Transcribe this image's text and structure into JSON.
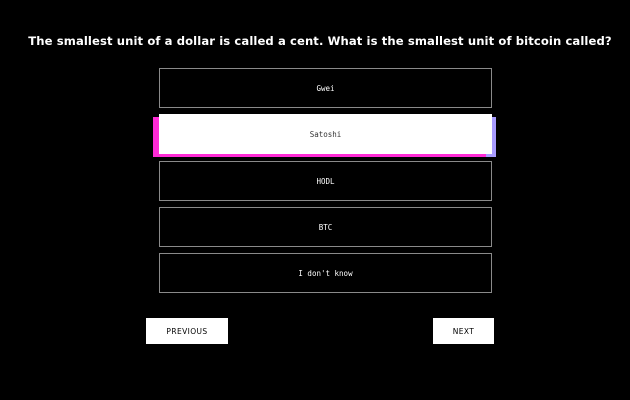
{
  "question": "The smallest unit of a dollar is called a cent. What is the smallest unit of bitcoin called?",
  "options": [
    {
      "label": "Gwei",
      "selected": false
    },
    {
      "label": "Satoshi",
      "selected": true
    },
    {
      "label": "HODL",
      "selected": false
    },
    {
      "label": "BTC",
      "selected": false
    },
    {
      "label": "I don't know",
      "selected": false
    }
  ],
  "nav": {
    "previous_label": "PREVIOUS",
    "next_label": "NEXT"
  },
  "colors": {
    "background": "#000000",
    "accent_left": "#ff2bd6",
    "accent_right": "#a89bff"
  }
}
